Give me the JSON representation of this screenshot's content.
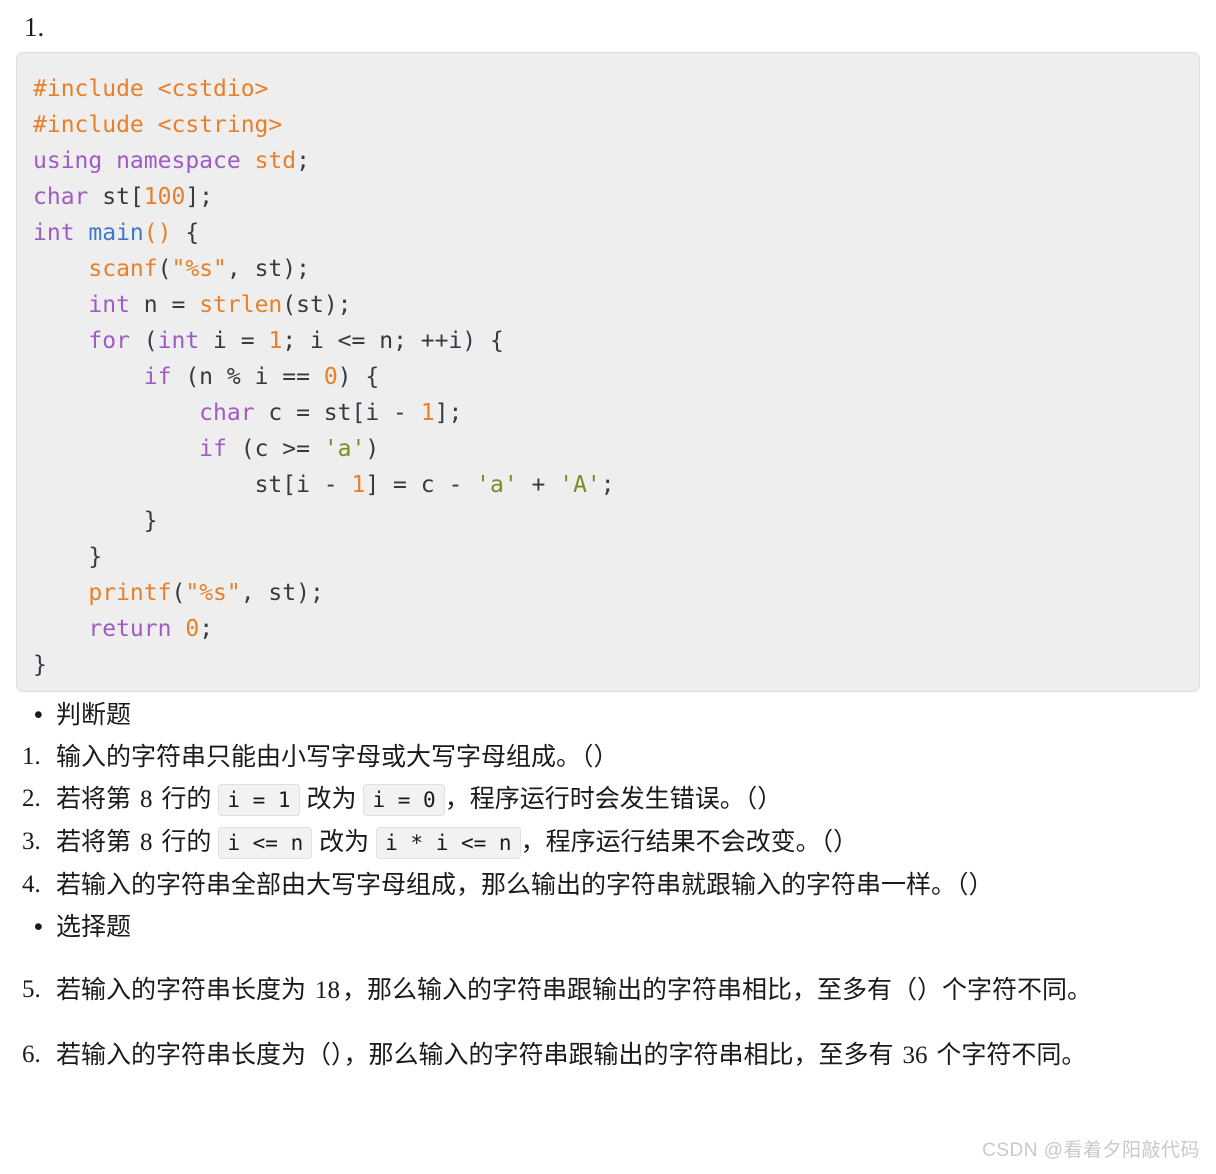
{
  "top_marker": "1.",
  "code": {
    "language": "cpp",
    "background": "#eeeeee",
    "border": "#dddddd",
    "colors": {
      "preprocessor": "#e8802a",
      "keyword": "#a05bc4",
      "function": "#e8802a",
      "identifier_blue": "#4078c8",
      "number": "#e8802a",
      "string": "#e8802a",
      "char_literal": "#7a8c24",
      "plain": "#383a42"
    },
    "lines": [
      "#include <cstdio>",
      "#include <cstring>",
      "using namespace std;",
      "char st[100];",
      "int main() {",
      "    scanf(\"%s\", st);",
      "    int n = strlen(st);",
      "    for (int i = 1; i <= n; ++i) {",
      "        if (n % i == 0) {",
      "            char c = st[i - 1];",
      "            if (c >= 'a')",
      "                st[i - 1] = c - 'a' + 'A';",
      "        }",
      "    }",
      "    printf(\"%s\", st);",
      "    return 0;",
      "}"
    ],
    "tokens": {
      "l1": {
        "pre": "#include",
        "inc": " <cstdio>"
      },
      "l2": {
        "pre": "#include",
        "inc": " <cstring>"
      },
      "l3": {
        "kw1": "using namespace",
        "id": " std",
        "pun": ";"
      },
      "l4": {
        "kw": "char",
        "id": " st[",
        "num": "100",
        "pun": "];"
      },
      "l5": {
        "kw": "int",
        "fn": " main",
        "paren": "()",
        "pun": " {"
      },
      "l6": {
        "fn": "scanf",
        "p1": "(",
        "str": "\"%s\"",
        "p2": ", st);"
      },
      "l7": {
        "kw": "int",
        "p1": " n = ",
        "fn": "strlen",
        "p2": "(st);"
      },
      "l8": {
        "kw": "for",
        "p1": " (",
        "kw2": "int",
        "p2": " i = ",
        "num": "1",
        "p3": "; i <= n; ++i) {"
      },
      "l9": {
        "kw": "if",
        "p1": " (n % i == ",
        "num": "0",
        "p2": ") {"
      },
      "l10": {
        "kw": "char",
        "p1": " c = st[i - ",
        "num": "1",
        "p2": "];"
      },
      "l11": {
        "kw": "if",
        "p1": " (c >= ",
        "chr": "'a'",
        "p2": ")"
      },
      "l12": {
        "p1": "st[i - ",
        "num": "1",
        "p2": "] = c - ",
        "chr1": "'a'",
        "p3": " + ",
        "chr2": "'A'",
        "p4": ";"
      },
      "l13": {
        "pun": "}"
      },
      "l14": {
        "pun": "}"
      },
      "l15": {
        "fn": "printf",
        "p1": "(",
        "str": "\"%s\"",
        "p2": ", st);"
      },
      "l16": {
        "kw": "return",
        "num": " 0",
        "pun": ";"
      },
      "l17": {
        "pun": "}"
      }
    }
  },
  "sections": {
    "judgement": {
      "bullet_label": "判断题",
      "items": [
        {
          "num": "1.",
          "parts": [
            {
              "type": "text",
              "value": "输入的字符串只能由小写字母或大写字母组成。（）"
            }
          ]
        },
        {
          "num": "2.",
          "parts": [
            {
              "type": "text",
              "value": "若将第 "
            },
            {
              "type": "math",
              "value": "8"
            },
            {
              "type": "text",
              "value": " 行的 "
            },
            {
              "type": "code",
              "value": "i = 1"
            },
            {
              "type": "text",
              "value": " 改为 "
            },
            {
              "type": "code",
              "value": "i = 0"
            },
            {
              "type": "text",
              "value": "，程序运行时会发生错误。（）"
            }
          ]
        },
        {
          "num": "3.",
          "parts": [
            {
              "type": "text",
              "value": "若将第 "
            },
            {
              "type": "math",
              "value": "8"
            },
            {
              "type": "text",
              "value": " 行的 "
            },
            {
              "type": "code",
              "value": "i <= n"
            },
            {
              "type": "text",
              "value": " 改为 "
            },
            {
              "type": "code",
              "value": "i * i <= n"
            },
            {
              "type": "text",
              "value": "，程序运行结果不会改变。（）"
            }
          ]
        },
        {
          "num": "4.",
          "parts": [
            {
              "type": "text",
              "value": "若输入的字符串全部由大写字母组成，那么输出的字符串就跟输入的字符串一样。（）"
            }
          ]
        }
      ]
    },
    "choice": {
      "bullet_label": "选择题",
      "items": [
        {
          "num": "5.",
          "parts": [
            {
              "type": "text",
              "value": "若输入的字符串长度为 "
            },
            {
              "type": "math",
              "value": "18"
            },
            {
              "type": "text",
              "value": "，那么输入的字符串跟输出的字符串相比，至多有（）个字符不同。"
            }
          ]
        },
        {
          "num": "6.",
          "parts": [
            {
              "type": "text",
              "value": "若输入的字符串长度为（），那么输入的字符串跟输出的字符串相比，至多有 "
            },
            {
              "type": "math",
              "value": "36"
            },
            {
              "type": "text",
              "value": " 个字符不同。"
            }
          ]
        }
      ]
    }
  },
  "watermark": "CSDN @看着夕阳敲代码"
}
